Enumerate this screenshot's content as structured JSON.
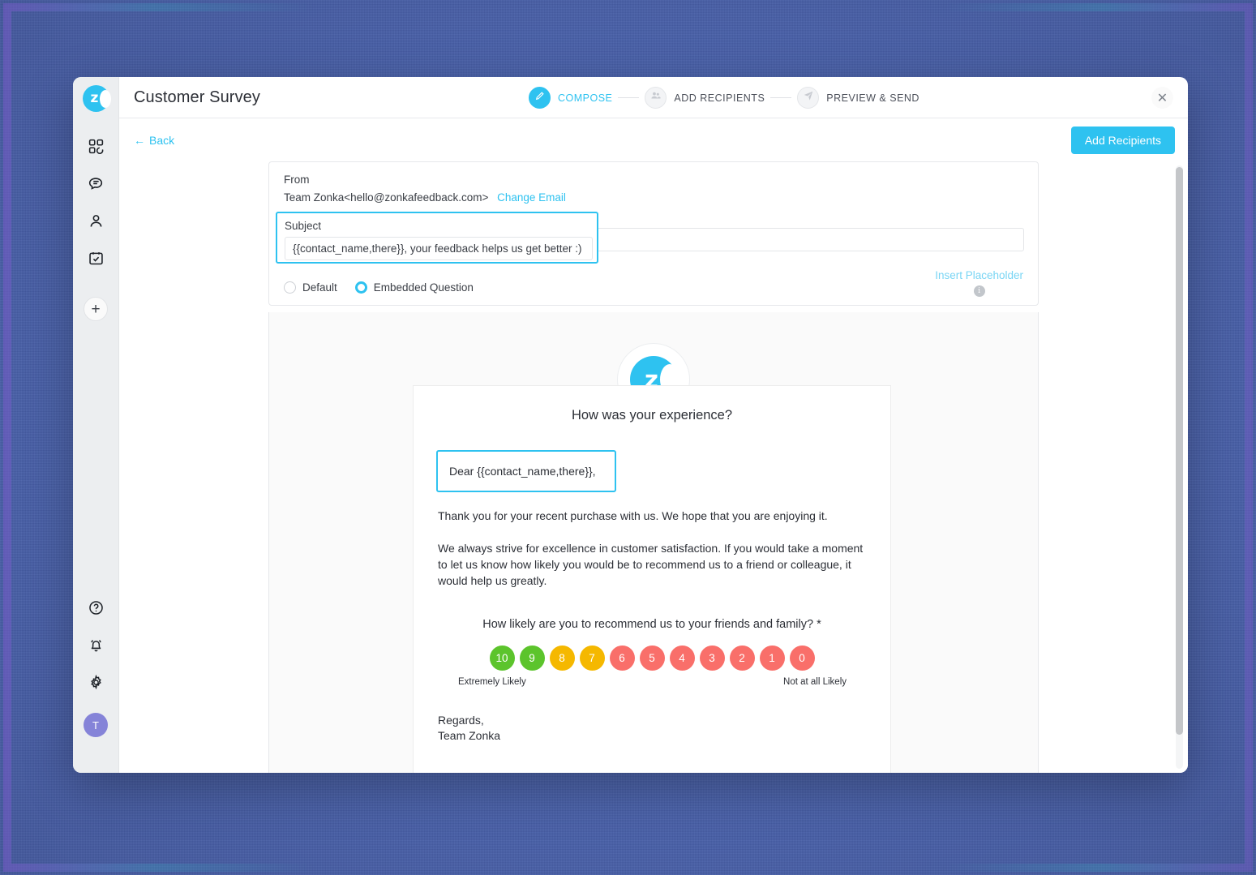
{
  "window": {
    "title": "Customer Survey",
    "close_label": "✕"
  },
  "brand": {
    "logo_letter": "z"
  },
  "sidebar": {
    "top_items": [
      {
        "name": "dashboard-icon",
        "label": "Dashboard"
      },
      {
        "name": "feedback-icon",
        "label": "Feedback"
      },
      {
        "name": "contacts-icon",
        "label": "Contacts"
      },
      {
        "name": "surveys-icon",
        "label": "Surveys"
      }
    ],
    "add_label": "+",
    "bottom_items": [
      {
        "name": "help-icon",
        "label": "Help"
      },
      {
        "name": "notifications-icon",
        "label": "Notifications"
      },
      {
        "name": "settings-icon",
        "label": "Settings"
      }
    ],
    "avatar_initial": "T"
  },
  "steps": [
    {
      "label": "COMPOSE",
      "icon": "pencil-icon",
      "active": true
    },
    {
      "label": "ADD RECIPIENTS",
      "icon": "people-icon",
      "active": false
    },
    {
      "label": "PREVIEW & SEND",
      "icon": "send-icon",
      "active": false
    }
  ],
  "subbar": {
    "back_label": "Back",
    "back_arrow": "←",
    "add_recipients_label": "Add Recipients"
  },
  "compose": {
    "from_label": "From",
    "from_value": "Team Zonka<hello@zonkafeedback.com>",
    "change_email_label": "Change Email",
    "subject_label": "Subject",
    "subject_value": "{{contact_name,there}}, your feedback helps us get better :)",
    "subject_placeholder": "Subject",
    "radios": [
      {
        "label": "Default",
        "checked": false
      },
      {
        "label": "Embedded Question",
        "checked": true
      }
    ],
    "insert_placeholder_label": "Insert Placeholder",
    "info_glyph": "i"
  },
  "preview": {
    "logo_letter": "z",
    "title": "How was your experience?",
    "greeting": "Dear {{contact_name,there}},",
    "paragraph1": "Thank you for your recent purchase with us. We hope that you are enjoying it.",
    "paragraph2": "We always strive for excellence in customer satisfaction. If you would take a moment to let us know how likely you would be to recommend us to a friend or colleague, it would help us greatly.",
    "nps_question": "How likely are you to recommend us to your friends and family? *",
    "nps_scores": [
      {
        "value": "10",
        "color": "#5cc42c"
      },
      {
        "value": "9",
        "color": "#5cc42c"
      },
      {
        "value": "8",
        "color": "#f5b800"
      },
      {
        "value": "7",
        "color": "#f5b800"
      },
      {
        "value": "6",
        "color": "#f96f6a"
      },
      {
        "value": "5",
        "color": "#f96f6a"
      },
      {
        "value": "4",
        "color": "#f96f6a"
      },
      {
        "value": "3",
        "color": "#f96f6a"
      },
      {
        "value": "2",
        "color": "#f96f6a"
      },
      {
        "value": "1",
        "color": "#f96f6a"
      },
      {
        "value": "0",
        "color": "#f96f6a"
      }
    ],
    "legend_left": "Extremely Likely",
    "legend_right": "Not at all Likely",
    "regards_line1": "Regards,",
    "regards_line2": "Team Zonka"
  },
  "colors": {
    "accent": "#2ec2f0",
    "backdrop": "#4a62ac",
    "nps_green": "#5cc42c",
    "nps_orange": "#f5b800",
    "nps_red": "#f96f6a",
    "avatar": "#8583d8"
  }
}
